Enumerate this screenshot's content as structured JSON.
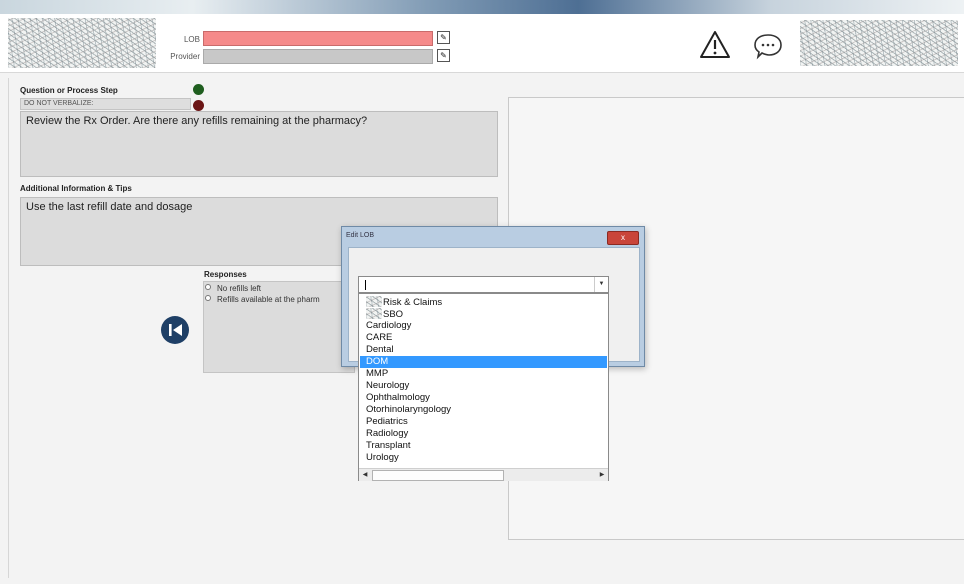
{
  "header": {
    "lob_label": "LOB",
    "provider_label": "Provider",
    "lob_value": "",
    "provider_value": "",
    "edit_icon_glyph": "✎",
    "icons": [
      "warning-icon",
      "chat-icon"
    ]
  },
  "question": {
    "title": "Question or Process Step",
    "verbal_tag": "DO NOT VERBALIZE:",
    "text": "Review the Rx Order. Are there any refills remaining at the pharmacy?"
  },
  "info": {
    "title": "Additional Information & Tips",
    "text": "Use the last refill date and dosage"
  },
  "responses": {
    "title": "Responses",
    "items": [
      "No refills left",
      "Refills available at the pharm"
    ]
  },
  "dialog": {
    "title": "Edit LOB",
    "close_glyph": "x",
    "combo_value": ""
  },
  "dropdown": {
    "options": [
      "Risk & Claims",
      "SBO",
      "Cardiology",
      "CARE",
      "Dental",
      "DOM",
      "MMP",
      "Neurology",
      "Ophthalmology",
      "Otorhinolaryngology",
      "Pediatrics",
      "Radiology",
      "Transplant",
      "Urology"
    ],
    "selected": "DOM"
  },
  "colors": {
    "lob_field": "#f58a8a",
    "selection": "#3399ff",
    "back_button": "#1e3f66",
    "status_green": "#1f5e1f",
    "status_red": "#6b1515"
  }
}
